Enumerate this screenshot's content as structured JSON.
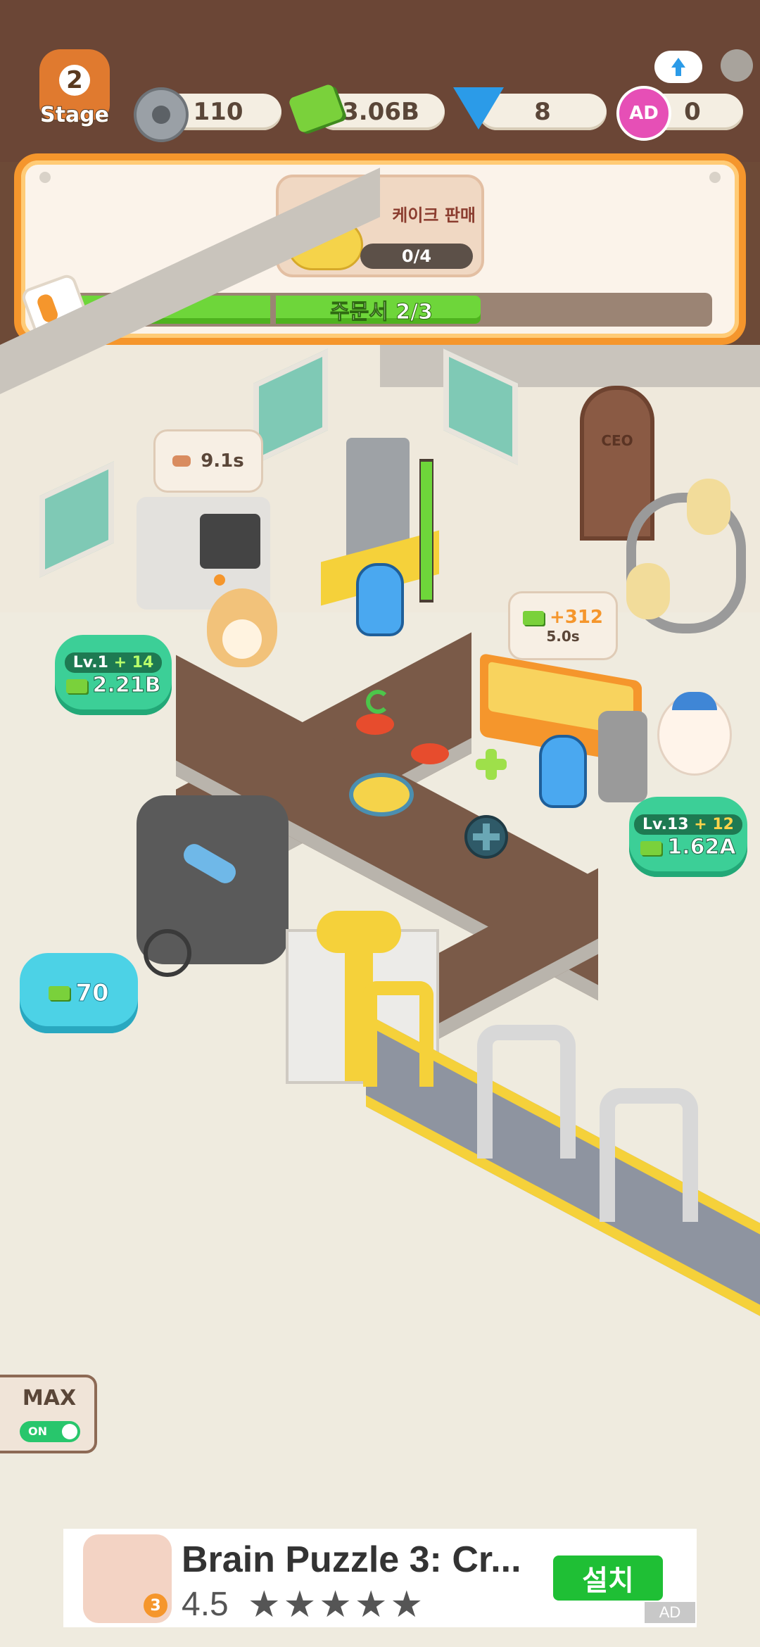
{
  "stage": {
    "number": "2",
    "label": "Stage"
  },
  "resources": {
    "bolts": "110",
    "cash": "3.06B",
    "gems": "8",
    "ad_tickets": "0",
    "ad_icon_text": "AD"
  },
  "order": {
    "item_name": "케이크 판매",
    "item_progress": "0/4",
    "sheet_label": "주문서 2/3",
    "progress_fraction": 0.64
  },
  "stations": {
    "oven_timer": "9.1s",
    "oven_level": "Lv.1",
    "oven_level_bonus": "+ 14",
    "oven_upgrade_cost": "2.21B",
    "mixer_reward": "+312",
    "mixer_timer": "5.0s",
    "mixer_level": "Lv.13",
    "mixer_level_bonus": "+ 12",
    "mixer_upgrade_cost": "1.62A",
    "buy_cost": "70",
    "ceo_door": "CEO"
  },
  "max_toggle": {
    "label": "MAX",
    "state": "ON"
  },
  "ad_banner": {
    "title": "Brain Puzzle 3: Cr...",
    "rating": "4.5",
    "install": "설치",
    "badge": "AD",
    "app_icon_num": "3"
  },
  "colors": {
    "accent_orange": "#f5962c",
    "progress_green": "#6ed63a",
    "cash_green": "#3ccf97"
  }
}
